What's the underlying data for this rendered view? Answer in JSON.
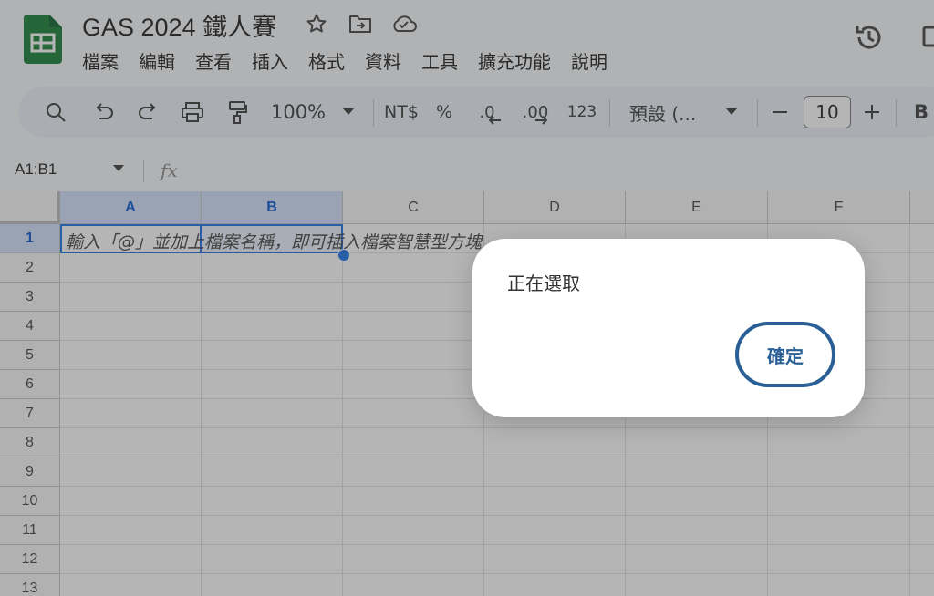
{
  "doc": {
    "title": "GAS 2024 鐵人賽"
  },
  "menu": [
    "檔案",
    "編輯",
    "查看",
    "插入",
    "格式",
    "資料",
    "工具",
    "擴充功能",
    "說明"
  ],
  "toolbar": {
    "zoom": "100%",
    "currency": "NT$",
    "percent": "%",
    "dec_decrease": ".0",
    "dec_increase": ".00",
    "number_format": "123",
    "font": "預設 (...",
    "font_size": "10",
    "bold": "B"
  },
  "namebox": {
    "value": "A1:B1"
  },
  "formula": {
    "fx_label": "fx"
  },
  "columns": [
    "A",
    "B",
    "C",
    "D",
    "E",
    "F"
  ],
  "rows": [
    "1",
    "2",
    "3",
    "4",
    "5",
    "6",
    "7",
    "8",
    "9",
    "10",
    "11",
    "12",
    "13"
  ],
  "cell_a1": "輸入「@」並加上檔案名稱，即可插入檔案智慧型方塊",
  "dialog": {
    "message": "正在選取",
    "ok_label": "確定"
  },
  "colors": {
    "selection": "#1a73e8",
    "sheets_green": "#188038",
    "dialog_button": "#2a5f96"
  }
}
